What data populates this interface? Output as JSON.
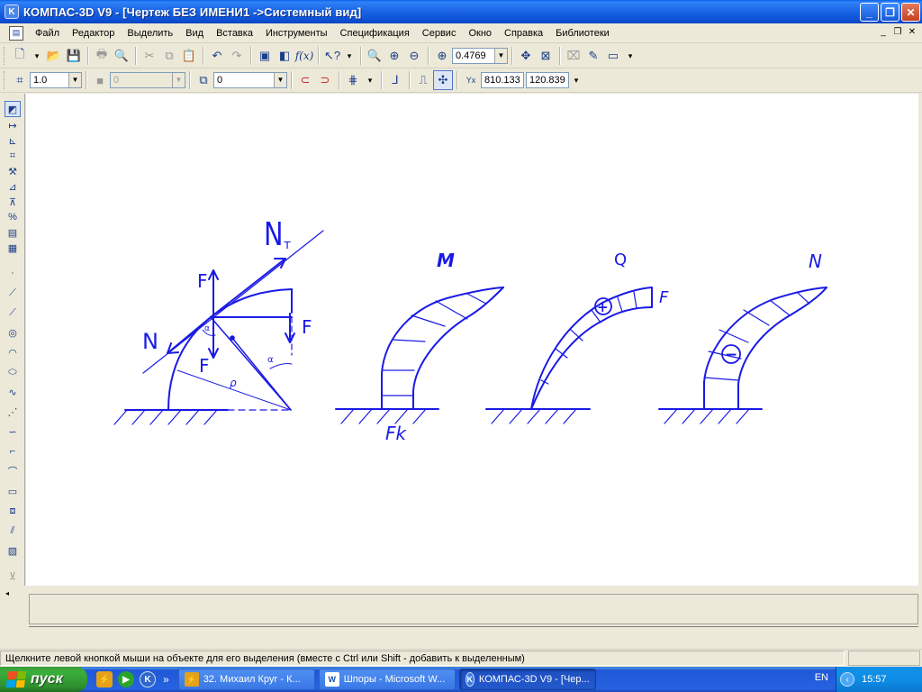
{
  "window": {
    "title": "КОМПАС-3D V9 - [Чертеж БЕЗ ИМЕНИ1 ->Системный вид]",
    "minimize": "_",
    "maximize": "❐",
    "close": "✕"
  },
  "menu": {
    "items": [
      {
        "label": "Файл"
      },
      {
        "label": "Редактор"
      },
      {
        "label": "Выделить"
      },
      {
        "label": "Вид"
      },
      {
        "label": "Вставка"
      },
      {
        "label": "Инструменты"
      },
      {
        "label": "Спецификация"
      },
      {
        "label": "Сервис"
      },
      {
        "label": "Окно"
      },
      {
        "label": "Справка"
      },
      {
        "label": "Библиотеки"
      }
    ],
    "mdi": [
      "_",
      "❐",
      "✕"
    ]
  },
  "toolbar1": {
    "zoom_value": "0.4769"
  },
  "toolbar2": {
    "scale_value": "1.0",
    "style_value": "0",
    "layer_value": "0",
    "coord_x": "810.133",
    "coord_y": "120.839"
  },
  "drawing": {
    "labels": {
      "nt": "N",
      "nt_sub": "т",
      "f_top": "F",
      "f_right": "F",
      "f_bottom": "F",
      "n": "N",
      "alpha_small": "α",
      "alpha": "α",
      "rho": "ρ",
      "m": "M",
      "q": "Q",
      "f_q": "F",
      "n_diag": "N",
      "fk": "Fk",
      "plus": "+",
      "minus": "−"
    },
    "color": "#1a1ae6"
  },
  "status": {
    "message": "Щелкните левой кнопкой мыши на объекте для его выделения (вместе с Ctrl или Shift - добавить к выделенным)"
  },
  "taskbar": {
    "start": "пуск",
    "more": "»",
    "tasks": [
      {
        "label": "32. Михаил Круг - К..."
      },
      {
        "label": "Шпоры - Microsoft W..."
      },
      {
        "label": "КОМПАС-3D V9 - [Чер..."
      }
    ],
    "language": "EN",
    "clock": "15:57"
  }
}
